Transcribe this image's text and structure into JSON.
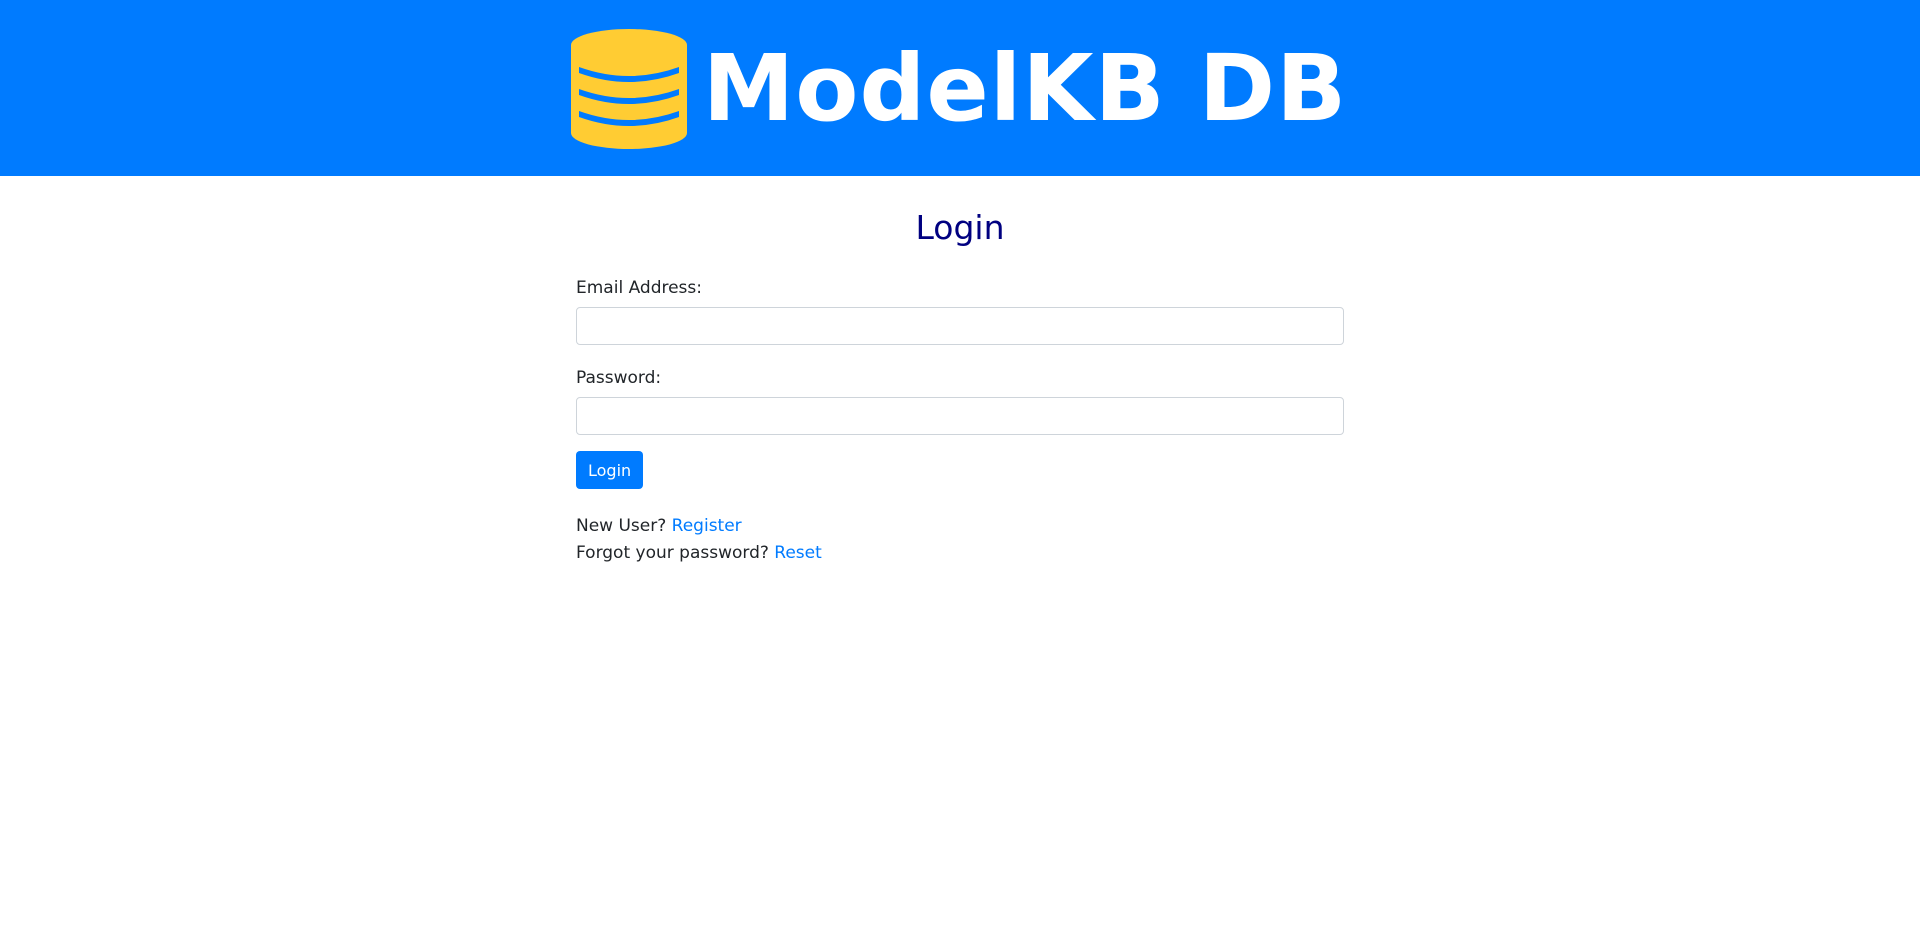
{
  "header": {
    "brand_title": "ModelKB DB",
    "logo_icon": "database-icon",
    "background_color": "#007bff",
    "icon_color": "#ffcc33"
  },
  "login": {
    "title": "Login",
    "email_label": "Email Address:",
    "email_value": "",
    "email_placeholder": "",
    "password_label": "Password:",
    "password_value": "",
    "password_placeholder": "",
    "submit_label": "Login",
    "new_user_text": "New User?",
    "register_link": "Register",
    "forgot_text": "Forgot your password?",
    "reset_link": "Reset"
  }
}
